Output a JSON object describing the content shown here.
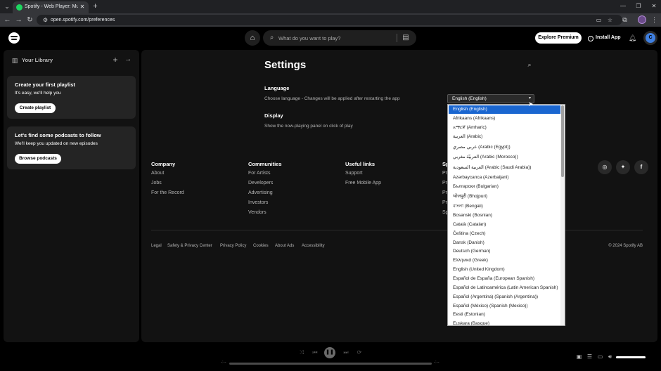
{
  "browser": {
    "tab_title": "Spotify - Web Player: Music for everyone",
    "url": "open.spotify.com/preferences",
    "icons": {
      "tab_search": "chevron-down-icon",
      "tab_close": "close-icon",
      "new_tab": "plus-icon",
      "minimize": "minimize-icon",
      "maximize": "maximize-icon",
      "close": "close-icon"
    }
  },
  "topbar": {
    "search_placeholder": "What do you want to play?",
    "explore_premium": "Explore Premium",
    "install_app": "Install App",
    "avatar_letter": "C"
  },
  "library": {
    "title": "Your Library",
    "cards": [
      {
        "title": "Create your first playlist",
        "subtitle": "It's easy, we'll help you",
        "button": "Create playlist"
      },
      {
        "title": "Let's find some podcasts to follow",
        "subtitle": "We'll keep you updated on new episodes",
        "button": "Browse podcasts"
      }
    ]
  },
  "settings": {
    "title": "Settings",
    "language_heading": "Language",
    "language_desc": "Choose language - Changes will be applied after restarting the app",
    "language_selected": "English (English)",
    "display_heading": "Display",
    "display_desc": "Show the now-playing panel on click of play"
  },
  "language_options": [
    "English (English)",
    "Afrikaans (Afrikaans)",
    "አማርኛ (Amharic)",
    "العربية (Arabic)",
    "عربي مصري (Arabic (Egypt))",
    "العربيّة مغربي (Arabic (Morocco))",
    "العربية السعودية (Arabic (Saudi Arabia))",
    "Azərbaycanca (Azerbaijani)",
    "Български (Bulgarian)",
    "भोजपुरी (Bhojpuri)",
    "বাংলা (Bengali)",
    "Bosanski (Bosnian)",
    "Català (Catalan)",
    "Čeština (Czech)",
    "Dansk (Danish)",
    "Deutsch (German)",
    "Ελληνικά (Greek)",
    "English (United Kingdom)",
    "Español de España (European Spanish)",
    "Español de Latinoamérica (Latin American Spanish)",
    "Español (Argentina) (Spanish (Argentina))",
    "Español (México) (Spanish (Mexico))",
    "Eesti (Estonian)",
    "Euskara (Basque)"
  ],
  "footer": {
    "columns": [
      {
        "heading": "Company",
        "links": [
          "About",
          "Jobs",
          "For the Record"
        ]
      },
      {
        "heading": "Communities",
        "links": [
          "For Artists",
          "Developers",
          "Advertising",
          "Investors",
          "Vendors"
        ]
      },
      {
        "heading": "Useful links",
        "links": [
          "Support",
          "Free Mobile App"
        ]
      },
      {
        "heading": "Sp",
        "links": [
          "Pr",
          "Pr",
          "Pr",
          "Pr",
          "Sp"
        ]
      }
    ],
    "social": [
      "instagram-icon",
      "twitter-icon",
      "facebook-icon"
    ],
    "legal": [
      "Legal",
      "Safety & Privacy Center",
      "Privacy Policy",
      "Cookies",
      "About Ads",
      "Accessibility"
    ],
    "copyright": "© 2024 Spotify AB"
  },
  "player": {
    "time_elapsed": "-:--",
    "time_total": "-:--",
    "volume_fraction": 1.0
  }
}
